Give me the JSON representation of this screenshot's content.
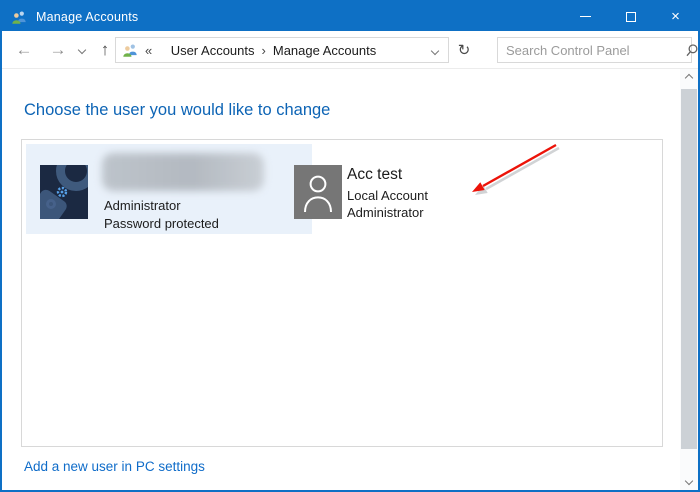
{
  "window": {
    "title": "Manage Accounts",
    "close_glyph": "×"
  },
  "navbar": {
    "back_glyph": "←",
    "forward_glyph": "→",
    "up_glyph": "↑",
    "refresh_glyph": "↻",
    "breadcrumb": {
      "collapsed_glyph": "«",
      "separator_glyph": "›",
      "items": [
        {
          "label": "User Accounts"
        },
        {
          "label": "Manage Accounts"
        }
      ]
    },
    "search": {
      "placeholder": "Search Control Panel"
    }
  },
  "main": {
    "heading": "Choose the user you would like to change",
    "users": [
      {
        "name_redacted": true,
        "role": "Administrator",
        "status": "Password protected"
      },
      {
        "name": "Acc test",
        "account_type": "Local Account",
        "role": "Administrator"
      }
    ],
    "footer_link": "Add a new user in PC settings"
  },
  "colors": {
    "titlebar": "#0e70c5",
    "heading": "#0d64b5",
    "link": "#0f6cc9",
    "annotation_arrow": "#ec1309",
    "tile_highlight": "#e9f1fa"
  }
}
